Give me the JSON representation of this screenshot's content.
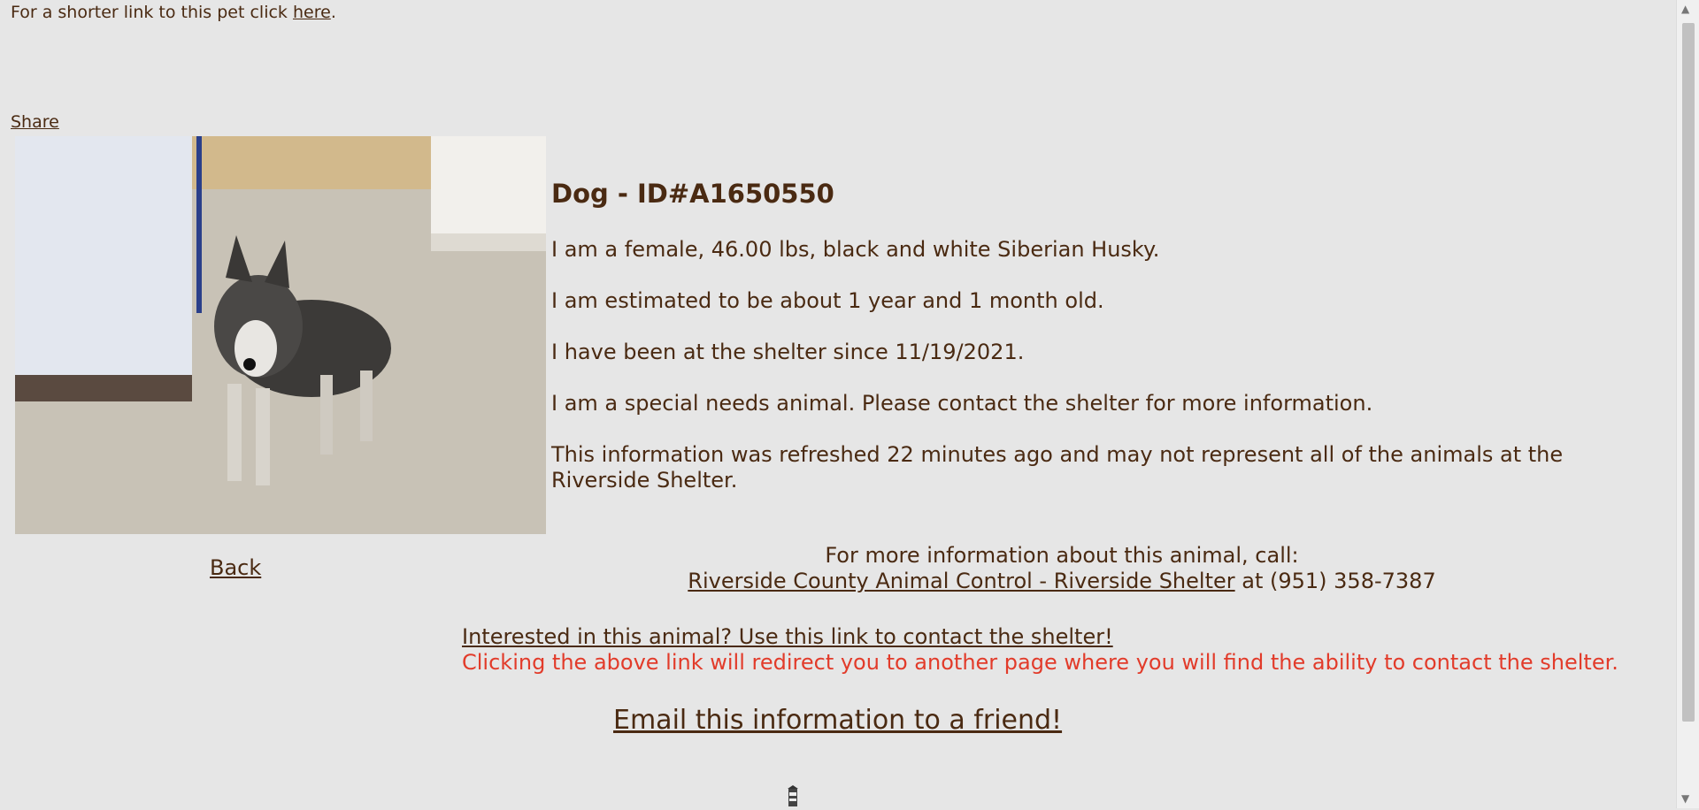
{
  "top": {
    "prefix": "For a shorter link to this pet click ",
    "link": "here",
    "suffix": "."
  },
  "share": "Share",
  "animal": {
    "title": "Dog - ID#A1650550",
    "line1": "I am a female, 46.00 lbs, black and white Siberian Husky.",
    "line2": "I am estimated to be about 1 year and 1 month old.",
    "line3": "I have been at the shelter since 11/19/2021.",
    "line4": "I am a special needs animal. Please contact the shelter for more information.",
    "line5": "This information was refreshed 22 minutes ago and may not represent all of the animals at the Riverside Shelter."
  },
  "back": "Back",
  "contact": {
    "label": "For more information about this animal, call:",
    "shelter_link": "Riverside County Animal Control - Riverside Shelter",
    "phone_text": " at (951) 358-7387"
  },
  "interest": {
    "link": "Interested in this animal? Use this link to contact the shelter!",
    "warning": "Clicking the above link will redirect you to another page where you will find the ability to contact the shelter."
  },
  "email_link": "Email this information to a friend!",
  "icons": {
    "scroll_up": "chevron-up-icon",
    "scroll_down": "chevron-down-icon",
    "bottom_small": "lighthouse-icon"
  },
  "colors": {
    "background": "#e6e6e6",
    "text": "#4a2a12",
    "warning": "#e23b2a"
  }
}
